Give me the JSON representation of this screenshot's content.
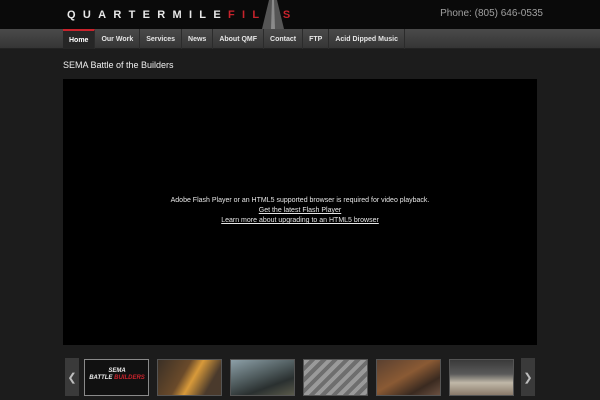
{
  "header": {
    "logo_white": "QUARTERMILE",
    "logo_red": "FILMS",
    "phone": "Phone: (805) 646-0535"
  },
  "nav": {
    "items": [
      {
        "label": "Home",
        "active": true
      },
      {
        "label": "Our Work"
      },
      {
        "label": "Services"
      },
      {
        "label": "News"
      },
      {
        "label": "About QMF"
      },
      {
        "label": "Contact"
      },
      {
        "label": "FTP"
      },
      {
        "label": "Acid Dipped Music"
      }
    ]
  },
  "page": {
    "title": "SEMA Battle of the Builders"
  },
  "player": {
    "message": "Adobe Flash Player or an HTML5 supported browser is required for video playback.",
    "link_flash": "Get the latest Flash Player",
    "link_html5": "Learn more about upgrading to an HTML5 browser"
  },
  "carousel": {
    "prev_icon": "chevron-left-icon",
    "next_icon": "chevron-right-icon",
    "first_thumb_title_top": "SEMA",
    "first_thumb_title": "BATTLE",
    "first_thumb_title_red": "BUILDERS"
  },
  "colors": {
    "accent": "#c8232c",
    "background": "#1c1c1c",
    "navbar": "#404040"
  }
}
